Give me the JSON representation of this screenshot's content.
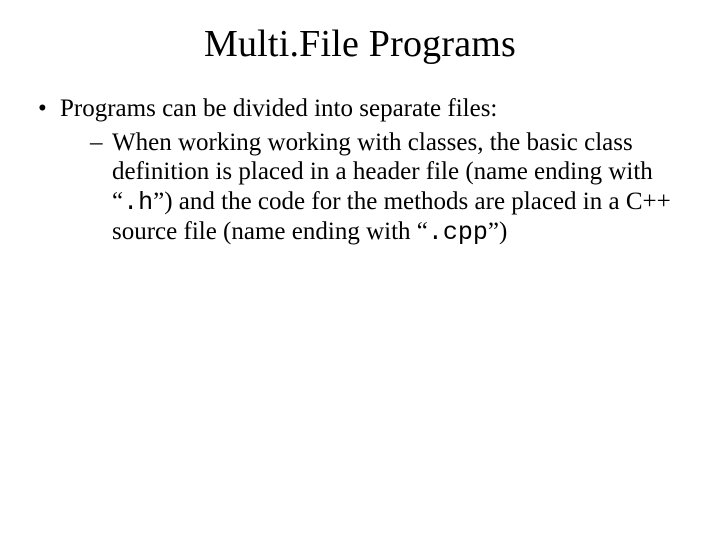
{
  "title": "Multi.File Programs",
  "bullet1": "Programs can be divided into separate files:",
  "sub_part1": "When working working with classes, the basic class definition is placed in a header file (name ending with “",
  "sub_code1": ".h",
  "sub_part2": "”) and the code for the methods are placed in a C++ source file (name ending with “",
  "sub_code2": ".cpp",
  "sub_part3": "”)"
}
